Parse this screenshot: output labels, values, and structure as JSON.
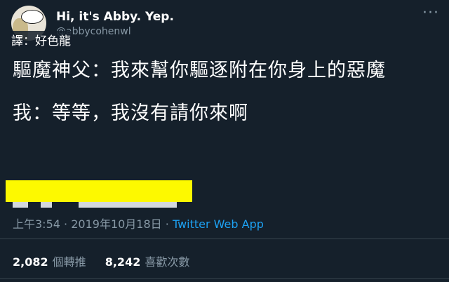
{
  "user": {
    "display_name": "Hi, it's Abby. Yep.",
    "handle": "@abbycohenwl"
  },
  "translator_credit": "譯：好色龍",
  "tweet": {
    "line1": "驅魔神父：我來幫你驅逐附在你身上的惡魔",
    "line2": "我：等等，我沒有請你來啊"
  },
  "meta": {
    "time": "上午3:54",
    "date": "2019年10月18日",
    "separator": "·",
    "app": "Twitter Web App"
  },
  "stats": {
    "retweets": "2,082",
    "retweets_label": "個轉推",
    "likes": "8,242",
    "likes_label": "喜歡次數"
  },
  "colors": {
    "background": "#15202b",
    "muted": "#8899a6",
    "link": "#1da1f2",
    "redaction": "#fdf900"
  },
  "icons": {
    "more": "more-dots-icon"
  }
}
